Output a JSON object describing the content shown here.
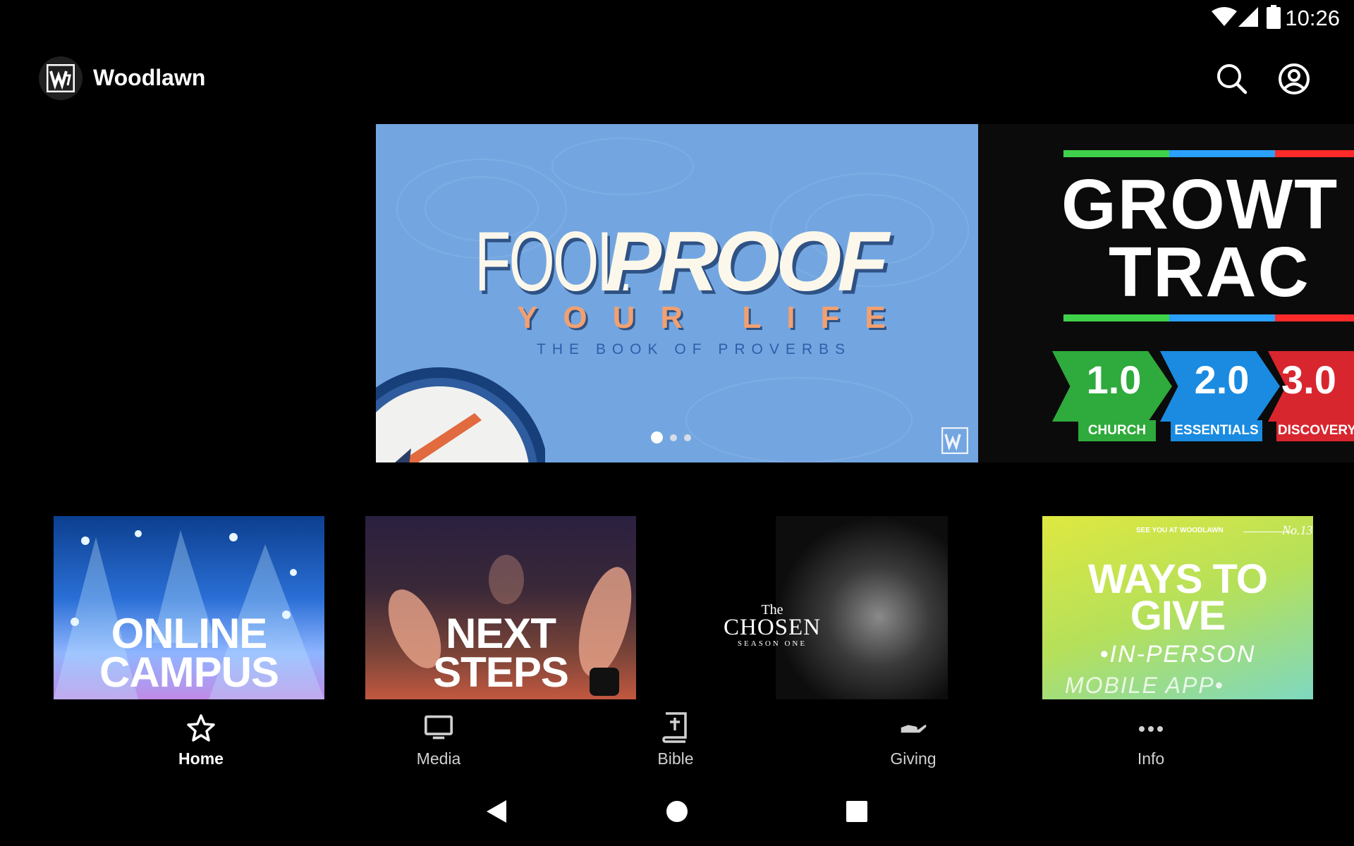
{
  "status_bar": {
    "time": "10:26",
    "icons": [
      "wifi-icon",
      "cell-signal-icon",
      "battery-icon"
    ]
  },
  "app_bar": {
    "title": "Woodlawn",
    "logo": "woodlawn-logo",
    "actions": [
      "search-icon",
      "account-icon"
    ]
  },
  "hero": {
    "main": {
      "title_part1": "FOOL",
      "title_part2": "PROOF",
      "subtitle": "YOUR LIFE",
      "tagline": "THE BOOK OF PROVERBS"
    },
    "next": {
      "title_line1": "GROWT",
      "title_line2": "TRAC",
      "badges": [
        {
          "number": "1.0",
          "label": "CHURCH",
          "color": "#2faa3c"
        },
        {
          "number": "2.0",
          "label": "ESSENTIALS",
          "color": "#1a8be0"
        },
        {
          "number": "3.0",
          "label": "DISCOVERY",
          "color": "#d8262f"
        }
      ]
    },
    "pagination": {
      "count": 3,
      "active": 0
    }
  },
  "cards": [
    {
      "line1": "ONLINE",
      "line2": "CAMPUS"
    },
    {
      "line1": "NEXT",
      "line2": "STEPS"
    },
    {
      "line1": "The",
      "line2": "CHOSEN",
      "line3": "SEASON ONE"
    },
    {
      "header_left": "SEE YOU AT WOODLAWN",
      "header_right": "No.13",
      "line1": "WAYS TO",
      "line2": "GIVE",
      "line3": "•IN-PERSON",
      "line4": "MOBILE APP•"
    }
  ],
  "bottom_nav": [
    {
      "label": "Home",
      "icon": "star-icon",
      "active": true
    },
    {
      "label": "Media",
      "icon": "monitor-icon",
      "active": false
    },
    {
      "label": "Bible",
      "icon": "bible-icon",
      "active": false
    },
    {
      "label": "Giving",
      "icon": "giving-hand-icon",
      "active": false
    },
    {
      "label": "Info",
      "icon": "more-dots-icon",
      "active": false
    }
  ],
  "colors": {
    "background": "#000000",
    "hero_blue": "#73a6e0",
    "nav_inactive": "#d0d0d0"
  }
}
